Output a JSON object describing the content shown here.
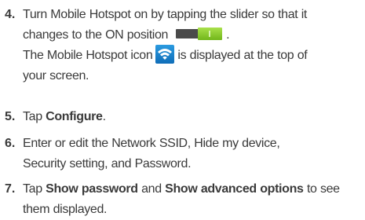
{
  "steps": [
    {
      "number": "4.",
      "line1": "Turn Mobile Hotspot on by tapping the slider so that it",
      "line2": "changes to the ON position",
      "line2_end": ".",
      "line3_before": "The Mobile Hotspot icon",
      "line3_after": "is displayed at the top of",
      "line4": "your screen."
    },
    {
      "number": "5.",
      "pre": "Tap ",
      "bold": "Configure",
      "post": "."
    },
    {
      "number": "6.",
      "line1": "Enter or edit the Network SSID, Hide my device,",
      "line2": "Security setting, and Password."
    },
    {
      "number": "7.",
      "pre": "Tap ",
      "bold1": "Show password",
      "mid": " and ",
      "bold2": "Show advanced options",
      "post": " to see",
      "line2": "them displayed."
    }
  ],
  "icons": {
    "slider": "toggle-on-slider",
    "hotspot": "wifi-hotspot-icon"
  },
  "colors": {
    "text": "#3a3a3a",
    "slider_on": "#8fd02c",
    "slider_track": "#4a4a4a",
    "hotspot_icon_bg": "#1a86d0"
  }
}
